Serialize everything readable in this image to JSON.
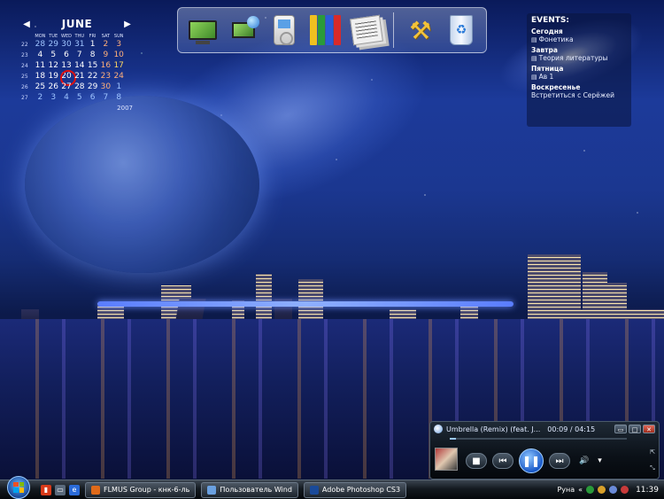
{
  "calendar": {
    "month": "JUNE",
    "year": "2007",
    "prev_arrow": "◀",
    "next_arrow": "▶",
    "dows": [
      "MON",
      "TUE",
      "WED",
      "THU",
      "FRI",
      "SAT",
      "SUN"
    ],
    "weeks": [
      {
        "wk": "22",
        "days": [
          "28",
          "29",
          "30",
          "31",
          "1",
          "2",
          "3"
        ]
      },
      {
        "wk": "23",
        "days": [
          "4",
          "5",
          "6",
          "7",
          "8",
          "9",
          "10"
        ]
      },
      {
        "wk": "24",
        "days": [
          "11",
          "12",
          "13",
          "14",
          "15",
          "16",
          "17"
        ]
      },
      {
        "wk": "25",
        "days": [
          "18",
          "19",
          "20",
          "21",
          "22",
          "23",
          "24"
        ]
      },
      {
        "wk": "26",
        "days": [
          "25",
          "26",
          "27",
          "28",
          "29",
          "30",
          "1"
        ]
      },
      {
        "wk": "27",
        "days": [
          "2",
          "3",
          "4",
          "5",
          "6",
          "7",
          "8"
        ]
      }
    ]
  },
  "dock": {
    "items": [
      "monitor-icon",
      "network-icon",
      "ipod-icon",
      "binders-icon",
      "papers-icon",
      "tools-icon",
      "recycle-bin-icon"
    ]
  },
  "events": {
    "title": "EVENTS:",
    "groups": [
      {
        "day": "Сегодня",
        "item": "Фонетика"
      },
      {
        "day": "Завтра",
        "item": "Теория литературы"
      },
      {
        "day": "Пятница",
        "item": "Ав 1"
      },
      {
        "day": "Воскресенье",
        "item": "Встретиться с Серёжей"
      }
    ]
  },
  "player": {
    "track": "Umbrella (Remix) (feat. J...",
    "time": "00:09 / 04:15",
    "progress_fraction": 0.035,
    "buttons": {
      "stop": "■",
      "prev": "⏮",
      "play": "❚❚",
      "next": "⏭",
      "volume": "🔊",
      "volume_arrow": "▾"
    },
    "window": {
      "restore": "▭",
      "maximize": "□",
      "close": "✕"
    }
  },
  "taskbar": {
    "tasks": [
      {
        "label": "FLMUS Group - кнк-6-ль",
        "color": "#e06a1a"
      },
      {
        "label": "Пользователь Wind",
        "color": "#6aa0e0"
      },
      {
        "label": "Adobe Photoshop CS3",
        "color": "#1a4a9a"
      }
    ],
    "tray": {
      "lang": "Руна",
      "time": "11:39"
    }
  },
  "colors": {
    "accent": "#1a5ac8",
    "today_ring": "#e01010",
    "weekend": "#ffb07a"
  }
}
